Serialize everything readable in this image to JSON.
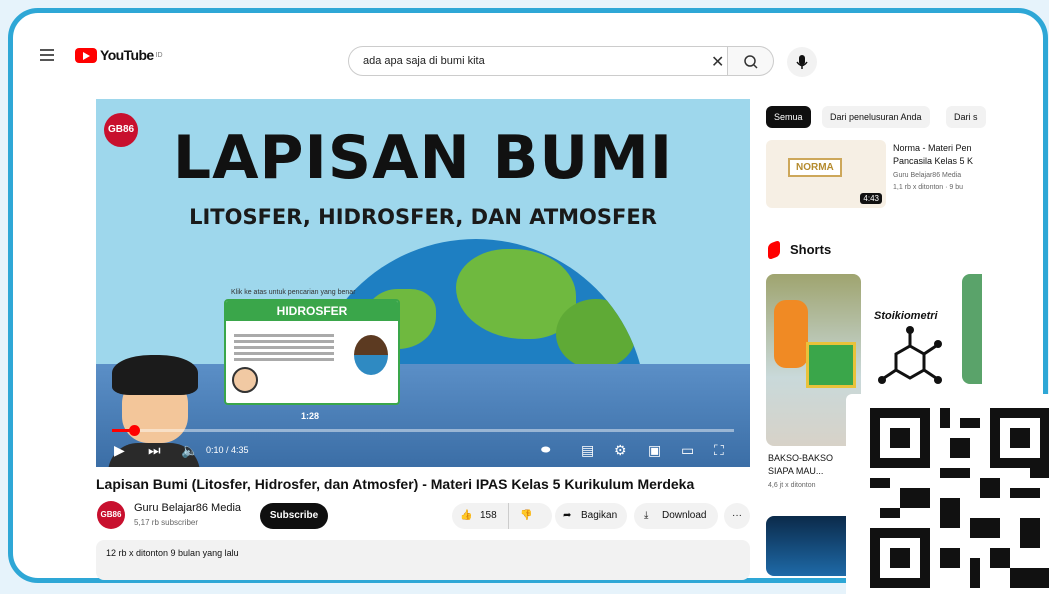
{
  "header": {
    "logo_text": "YouTube",
    "logo_superscript": "ID",
    "search_value": "ada apa saja di bumi kita",
    "brand_color": "#ff0000"
  },
  "video": {
    "channel_badge": "GB86",
    "headline": "LAPISAN BUMI",
    "subheadline": "LITOSFER, HIDROSFER, DAN ATMOSFER",
    "overlay_hint": "Klik ke atas untuk pencarian yang benar",
    "card_title": "HIDROSFER",
    "hover_time": "1:28",
    "current_time": "0:10 / 4:35",
    "progress_fraction": 0.036
  },
  "details": {
    "title": "Lapisan Bumi (Litosfer, Hidrosfer, dan Atmosfer) - Materi IPAS Kelas 5 Kurikulum Merdeka",
    "channel_avatar": "GB86",
    "channel_name": "Guru Belajar86 Media",
    "subscribers": "5,17 rb subscriber",
    "subscribe_label": "Subscribe",
    "like_count": "158",
    "share_label": "Bagikan",
    "download_label": "Download",
    "more_label": "···",
    "meta": "12 rb x ditonton  9 bulan yang lalu"
  },
  "sidebar": {
    "chips": [
      "Semua",
      "Dari penelusuran Anda",
      "Dari s"
    ],
    "recommended": {
      "thumb_text": "NORMA",
      "duration": "4:43",
      "title": "Norma - Materi Pen Pancasila Kelas 5 K",
      "channel": "Guru Belajar86 Media",
      "views": "1,1 rb x ditonton · 9 bu"
    },
    "shorts_label": "Shorts",
    "short1_title": "BAKSO-BAKSO SIAPA MAU...",
    "short1_views": "4,6 jt x ditonton",
    "short2_label": "Stoikiometri"
  }
}
